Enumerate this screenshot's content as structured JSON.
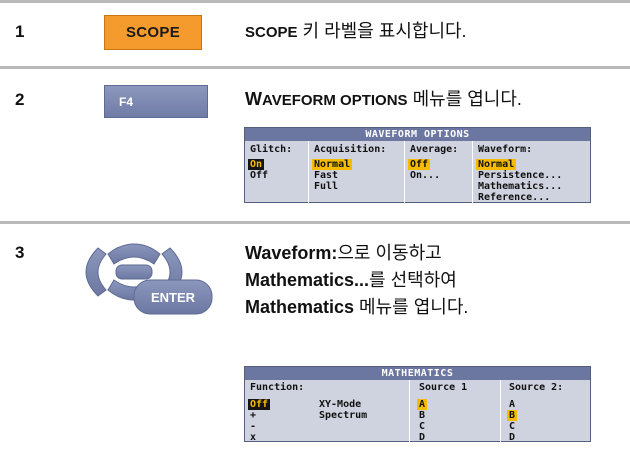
{
  "steps": [
    {
      "number": "1",
      "key_label": "SCOPE",
      "text_bold": "SCOPE",
      "text_rest": " 키 라벨을 표시합니다."
    },
    {
      "number": "2",
      "key_label": "F4",
      "text_bold_lead": "W",
      "text_bold_sc": "AVEFORM OPTIONS",
      "text_rest": " 메뉴를 엽니다."
    },
    {
      "number": "3",
      "key_label": "ENTER",
      "line1_bold": "Waveform:",
      "line1_rest": "으로 이동하고",
      "line2_bold": "Mathematics...",
      "line2_rest": "를 선택하여",
      "line3_bold": "Mathematics",
      "line3_rest": " 메뉴를 엽니다."
    }
  ],
  "waveform_options": {
    "title": "WAVEFORM OPTIONS",
    "columns": [
      {
        "header": "Glitch:",
        "items": [
          "On",
          "Off"
        ],
        "selected": 0
      },
      {
        "header": "Acquisition:",
        "items": [
          "Normal",
          "Fast",
          "Full"
        ],
        "selected": 0
      },
      {
        "header": "Average:",
        "items": [
          "Off",
          "On..."
        ],
        "selected": 0
      },
      {
        "header": "Waveform:",
        "items": [
          "Normal",
          "Persistence...",
          "Mathematics...",
          "Reference..."
        ],
        "selected": 0
      }
    ]
  },
  "mathematics": {
    "title": "MATHEMATICS",
    "function_header": "Function:",
    "function_items": [
      "Off",
      "+",
      "-",
      "x"
    ],
    "function_selected": 0,
    "mode_items": [
      "XY-Mode",
      "Spectrum"
    ],
    "source1_header": "Source 1",
    "source1_items": [
      "A",
      "B",
      "C",
      "D"
    ],
    "source1_selected": 0,
    "source2_header": "Source 2:",
    "source2_items": [
      "A",
      "B",
      "C",
      "D"
    ],
    "source2_selected": 1
  },
  "colors": {
    "scope_key": "#f59a2c",
    "function_key": "#7b87ae",
    "menu_bg": "#cfd3df",
    "menu_title": "#6b77a0",
    "highlight": "#f6bb00"
  }
}
